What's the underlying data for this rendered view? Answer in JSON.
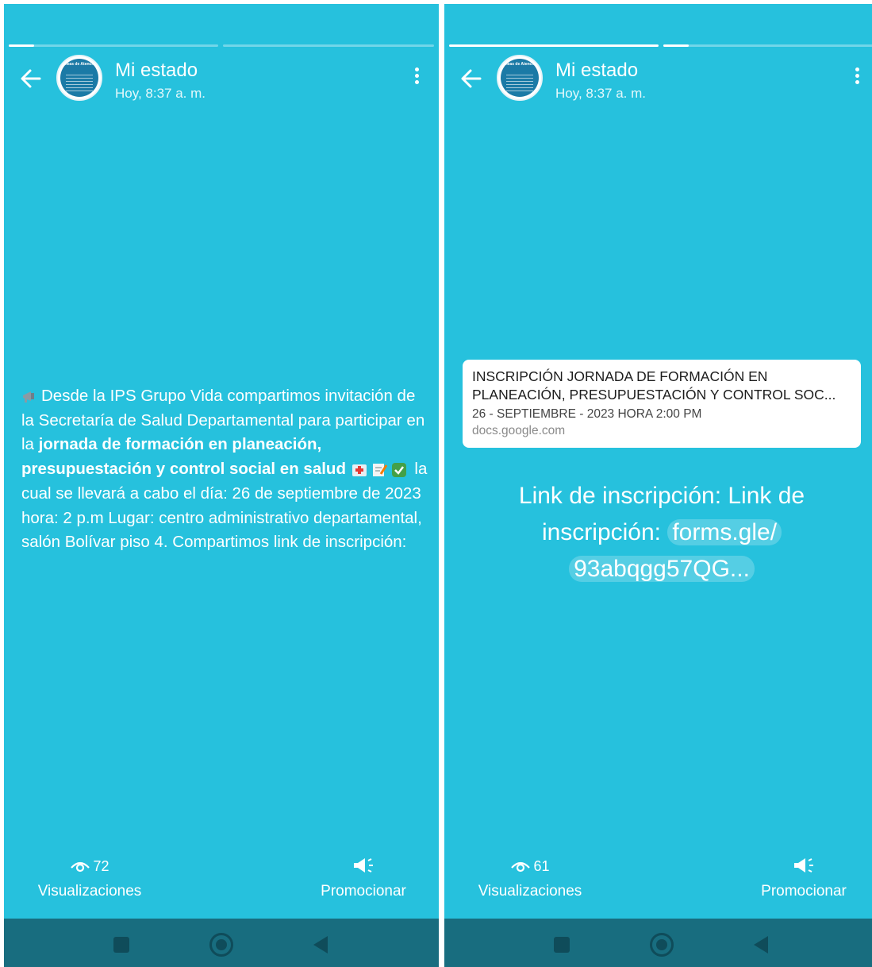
{
  "colors": {
    "status_bg": "#26c1dd",
    "nav_bar": "#186d7f",
    "nav_icons": "#0f4c5a",
    "text": "#ffffff",
    "card_bg": "#ffffff"
  },
  "left_panel": {
    "header": {
      "title": "Mi estado",
      "timestamp": "Hoy, 8:37 a. m.",
      "avatar_text": "Líneas de Atención",
      "back_icon": "arrow-left-icon",
      "menu_icon": "more-vertical-icon"
    },
    "progress": {
      "segments": 2,
      "active_segment": 1,
      "active_fill": 0.12
    },
    "status": {
      "text_part1": "Desde la IPS Grupo Vida compartimos invitación de la Secretaría de Salud Departamental para participar en la ",
      "text_bold": "jornada de formación en planeación, presupuestación y control social en salud",
      "text_part2": " la cual se llevará a cabo el día: 26 de septiembre de 2023 hora: 2 p.m Lugar: centro administrativo departamental, salón Bolívar piso 4. Compartimos link de inscripción:",
      "emoji_icons": [
        "megaphone-icon",
        "hospital-icon",
        "memo-icon",
        "check-mark-icon"
      ]
    },
    "footer": {
      "views_count": "72",
      "views_label": "Visualizaciones",
      "promote_label": "Promocionar",
      "views_icon": "eye-icon",
      "promote_icon": "megaphone-icon"
    }
  },
  "right_panel": {
    "header": {
      "title": "Mi estado",
      "timestamp": "Hoy, 8:37 a. m.",
      "avatar_text": "Líneas de Atención",
      "back_icon": "arrow-left-icon",
      "menu_icon": "more-vertical-icon"
    },
    "progress": {
      "segments": 2,
      "active_segment": 2,
      "active_fill": 0.12
    },
    "link_card": {
      "title": "INSCRIPCIÓN JORNADA DE FORMACIÓN EN PLANEACIÓN, PRESUPUESTACIÓN Y CONTROL SOC...",
      "description": "26 - SEPTIEMBRE - 2023 HORA 2:00 PM",
      "domain": "docs.google.com"
    },
    "status": {
      "prefix": "Link de inscripción: Link de inscripción: ",
      "link_part1": "forms.gle/",
      "link_part2": "93abqgg57QG..."
    },
    "footer": {
      "views_count": "61",
      "views_label": "Visualizaciones",
      "promote_label": "Promocionar",
      "views_icon": "eye-icon",
      "promote_icon": "megaphone-icon"
    }
  },
  "nav_bar": {
    "recents_icon": "square-icon",
    "home_icon": "circle-icon",
    "back_icon": "triangle-back-icon"
  }
}
